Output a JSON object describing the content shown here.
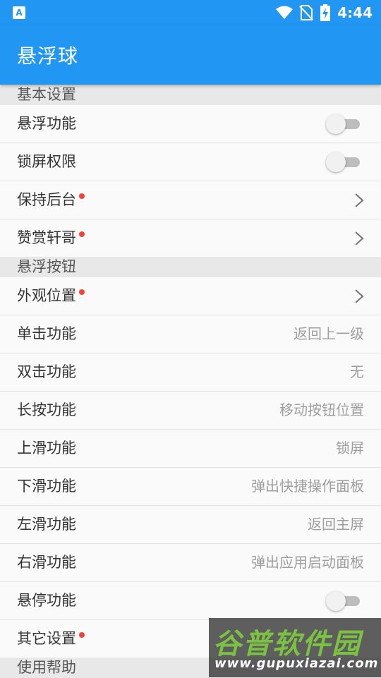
{
  "status_bar": {
    "notification_icon_letter": "A",
    "time": "4:44",
    "icons": [
      "wifi-icon",
      "no-sim-icon",
      "battery-charging-icon"
    ]
  },
  "app_bar": {
    "title": "悬浮球"
  },
  "sections": {
    "basic": {
      "header": "基本设置",
      "floating_function": {
        "label": "悬浮功能",
        "toggle_on": false
      },
      "lock_screen_permission": {
        "label": "锁屏权限",
        "toggle_on": false
      },
      "keep_background": {
        "label": "保持后台",
        "has_red_dot": true
      },
      "tip_author": {
        "label": "赞赏轩哥",
        "has_red_dot": true
      }
    },
    "button": {
      "header": "悬浮按钮",
      "appearance_position": {
        "label": "外观位置",
        "has_red_dot": true
      },
      "single_click": {
        "label": "单击功能",
        "value": "返回上一级"
      },
      "double_click": {
        "label": "双击功能",
        "value": "无"
      },
      "long_press": {
        "label": "长按功能",
        "value": "移动按钮位置"
      },
      "swipe_up": {
        "label": "上滑功能",
        "value": "锁屏"
      },
      "swipe_down": {
        "label": "下滑功能",
        "value": "弹出快捷操作面板"
      },
      "swipe_left": {
        "label": "左滑功能",
        "value": "返回主屏"
      },
      "swipe_right": {
        "label": "右滑功能",
        "value": "弹出应用启动面板"
      },
      "hover": {
        "label": "悬停功能",
        "toggle_on": false
      },
      "other_settings": {
        "label": "其它设置",
        "has_red_dot": true
      }
    },
    "help": {
      "header": "使用帮助"
    }
  },
  "watermark": {
    "chinese": "谷普软件园",
    "url": "www.gupuxiazai.com"
  },
  "colors": {
    "primary": "#2196f3",
    "section_header_bg": "#e8e8e8",
    "red_dot": "#f44336",
    "value_text": "#9e9e9e",
    "watermark_green": "#7cc242"
  }
}
